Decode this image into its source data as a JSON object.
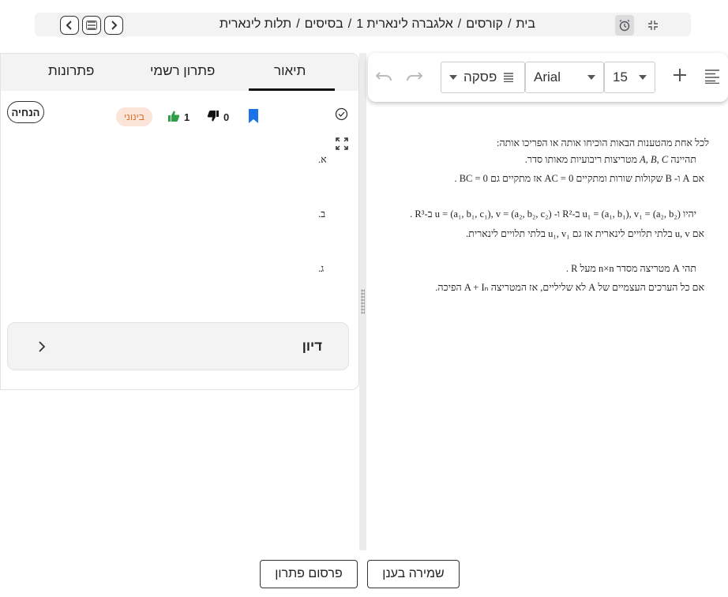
{
  "breadcrumb": {
    "items": [
      "בית",
      "קורסים",
      "אלגברה לינארית 1",
      "בסיסים",
      "תלות לינארית"
    ],
    "separator": "/"
  },
  "nav": {
    "back_icon": "chevron-left-icon",
    "menu_icon": "list-icon",
    "forward_icon": "chevron-right-icon"
  },
  "editor": {
    "paragraph_label": "פסקה",
    "font_label": "Arial",
    "size_label": "15",
    "icons": [
      "undo-icon",
      "redo-icon",
      "plus-icon",
      "align-icon"
    ]
  },
  "tabs": [
    {
      "label": "תיאור",
      "active": true
    },
    {
      "label": "פתרון רשמי",
      "active": false
    },
    {
      "label": "פתרונות",
      "active": false
    }
  ],
  "question": {
    "hint_label": "הנחיה",
    "difficulty": "בינוני",
    "likes": "1",
    "dislikes": "0",
    "intro": "לכל אחת מהטענות הבאות הוכיחו אותה או הפריכו אותה:",
    "a_label": "א.",
    "a_line1_pre": "תהיינה",
    "a_line1_math": "A, B, C",
    "a_line1_post": "מטריצות ריבועיות מאותו סדר.",
    "a_line2": "אם  A  ו-  B  שקולות שורות ומתקיים  AC = 0  אז מתקיים גם  BC = 0 .",
    "b_label": "ב.",
    "b_line1": "יהיו  u₁ = (a₁, b₁), v₁ = (a₂, b₂)  ב-R²  ו-  u = (a₁, b₁, c₁), v = (a₂, b₂, c₂)  ב-R³ .",
    "b_line2": "אם  u, v  בלתי תלויים לינארית אז גם  u₁, v₁  בלתי תלויים לינארית.",
    "c_label": "ג.",
    "c_line1": "תהי  A  מטריצה מסדר  n×n  מעל  R .",
    "c_line2": "אם כל הערכים העצמיים של  A  לא שליליים, אז המטריצה  A + Iₙ  הפיכה."
  },
  "discussion": {
    "label": "דיון"
  },
  "bottom": {
    "publish_label": "פרסום פתרון",
    "save_label": "שמירה בענן"
  },
  "colors": {
    "accent_blue": "#1a73e8",
    "like_green": "#2e9e47",
    "badge_bg": "#fbe4d8",
    "badge_text": "#d9702a"
  }
}
